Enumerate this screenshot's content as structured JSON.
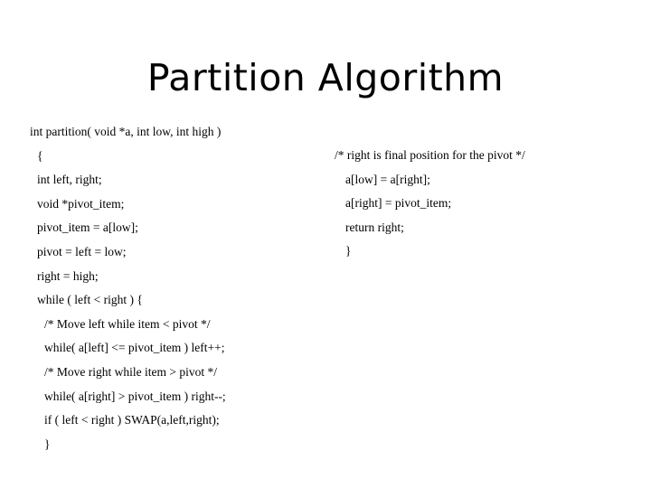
{
  "slide": {
    "title": "Partition Algorithm",
    "background_color": "#ffffff",
    "text_color": "#000000"
  },
  "code": {
    "left_column": [
      {
        "text": "int partition( void *a, int low, int high )",
        "indent": 0
      },
      {
        "text": "{",
        "indent": 1
      },
      {
        "text": "int left, right;",
        "indent": 1
      },
      {
        "text": "void *pivot_item;",
        "indent": 1
      },
      {
        "text": "pivot_item = a[low];",
        "indent": 1
      },
      {
        "text": "pivot = left = low;",
        "indent": 1
      },
      {
        "text": "right = high;",
        "indent": 1
      },
      {
        "text": "while ( left < right ) {",
        "indent": 1
      },
      {
        "text": "/* Move left while item < pivot */",
        "indent": 2
      },
      {
        "text": "while( a[left] <= pivot_item ) left++;",
        "indent": 2
      },
      {
        "text": "/* Move right while item > pivot */",
        "indent": 2
      },
      {
        "text": "while( a[right] > pivot_item ) right--;",
        "indent": 2
      },
      {
        "text": "if ( left < right ) SWAP(a,left,right);",
        "indent": 2
      },
      {
        "text": "}",
        "indent": 2
      }
    ],
    "right_column": [
      {
        "text": "/* right is final position for the pivot */",
        "indent": 0
      },
      {
        "text": "a[low] = a[right];",
        "indent": 1
      },
      {
        "text": "a[right] = pivot_item;",
        "indent": 1
      },
      {
        "text": "return right;",
        "indent": 1
      },
      {
        "text": "}",
        "indent": 1
      }
    ]
  }
}
